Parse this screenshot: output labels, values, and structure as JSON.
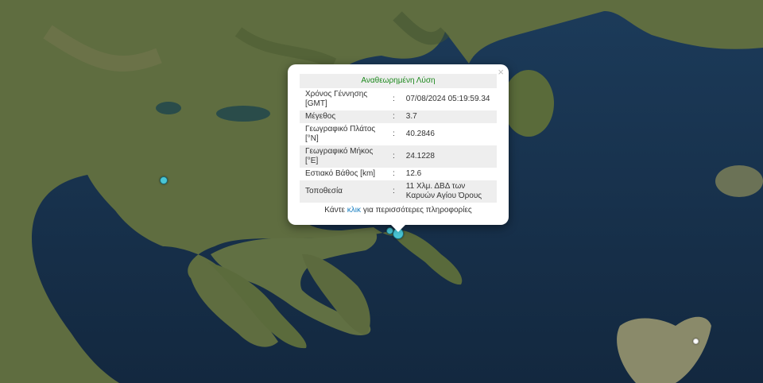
{
  "popup": {
    "title": "Αναθεωρημένη Λύση",
    "close": "×",
    "rows": [
      {
        "label": "Χρόνος Γέννησης [GMT]",
        "sep": ":",
        "value": "07/08/2024 05:19:59.34"
      },
      {
        "label": "Μέγεθος",
        "sep": ":",
        "value": "3.7"
      },
      {
        "label": "Γεωγραφικό Πλάτος [°N]",
        "sep": ":",
        "value": "40.2846"
      },
      {
        "label": "Γεωγραφικό Μήκος [°E]",
        "sep": ":",
        "value": "24.1228"
      },
      {
        "label": "Εστιακό Βάθος [km]",
        "sep": ":",
        "value": "12.6"
      },
      {
        "label": "Τοποθεσία",
        "sep": ":",
        "value": "11 Χλμ. ΔΒΔ των Καρυών Αγίου Όρους"
      }
    ],
    "more_prefix": "Κάντε",
    "more_link": "κλικ",
    "more_suffix": "για περισσότερες πληροφορίες"
  },
  "markers": [
    {
      "name": "earthquake-marker-main",
      "size": "large"
    },
    {
      "name": "earthquake-marker-nearby",
      "size": "small"
    },
    {
      "name": "earthquake-marker-inland",
      "size": "small"
    }
  ],
  "colors": {
    "sea": "#17304a",
    "land": "#5e6c3f",
    "marker": "#49c6d6",
    "title": "#1f8a1f",
    "link": "#1a7fc1"
  }
}
